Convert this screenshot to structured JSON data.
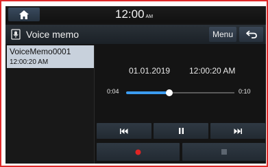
{
  "status_bar": {
    "clock": "12:00",
    "ampm": "AM",
    "home_icon": "home-icon"
  },
  "title_bar": {
    "title": "Voice memo",
    "title_icon": "voice-memo-icon",
    "menu_label": "Menu",
    "back_icon": "back-arrow-icon"
  },
  "recordings": [
    {
      "name": "VoiceMemo0001",
      "time": "12:00:20 AM",
      "selected": true
    }
  ],
  "player": {
    "date": "01.01.2019",
    "time": "12:00:20 AM",
    "elapsed": "0:04",
    "duration": "0:10",
    "progress": 0.4
  },
  "controls": {
    "previous_icon": "skip-previous-icon",
    "pause_icon": "pause-icon",
    "next_icon": "skip-next-icon",
    "record_icon": "record-icon",
    "stop_icon": "stop-icon",
    "record_color": "#e02424",
    "stop_enabled": false
  },
  "colors": {
    "frame_border": "#e02a2a",
    "accent": "#3b9cf0",
    "selected_item_bg": "#c8d1dc"
  }
}
